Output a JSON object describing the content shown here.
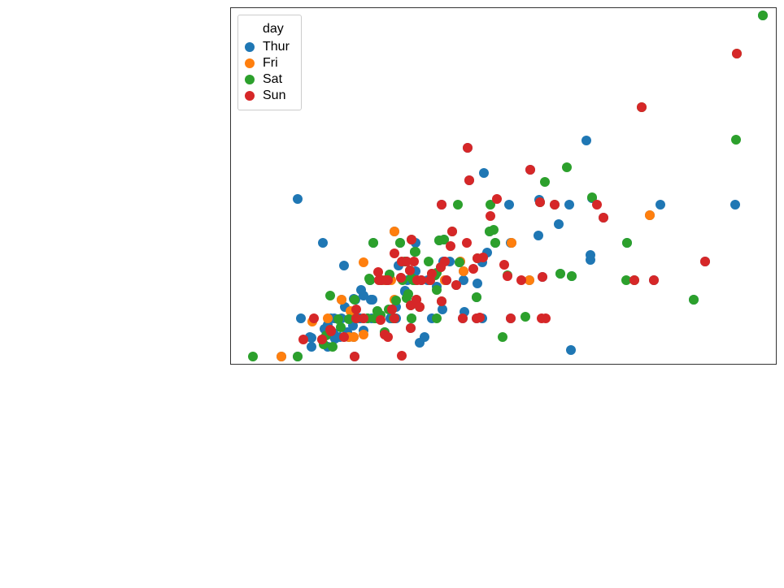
{
  "chart_data": {
    "type": "scatter",
    "legend_title": "day",
    "legend_labels": [
      "Thur",
      "Fri",
      "Sat",
      "Sun"
    ],
    "colors": {
      "Thur": "#1f77b4",
      "Fri": "#ff7f0e",
      "Sat": "#2ca02c",
      "Sun": "#d62728"
    },
    "xlim": [
      1,
      52
    ],
    "ylim": [
      0.8,
      10.2
    ],
    "series": [
      {
        "name": "Thur",
        "points": [
          [
            27.2,
            4.0
          ],
          [
            22.76,
            3.0
          ],
          [
            17.29,
            2.71
          ],
          [
            19.44,
            3.0
          ],
          [
            16.66,
            3.4
          ],
          [
            10.07,
            1.83
          ],
          [
            32.68,
            5.0
          ],
          [
            15.98,
            2.03
          ],
          [
            34.83,
            5.17
          ],
          [
            13.03,
            2.0
          ],
          [
            18.28,
            4.0
          ],
          [
            24.71,
            5.85
          ],
          [
            21.16,
            3.0
          ],
          [
            28.97,
            3.0
          ],
          [
            22.49,
            3.5
          ],
          [
            5.75,
            1.0
          ],
          [
            16.32,
            4.3
          ],
          [
            22.75,
            3.25
          ],
          [
            40.17,
            4.73
          ],
          [
            27.28,
            4.0
          ],
          [
            12.03,
            1.5
          ],
          [
            21.01,
            3.0
          ],
          [
            12.46,
            1.5
          ],
          [
            11.35,
            2.5
          ],
          [
            15.38,
            3.0
          ],
          [
            44.3,
            2.5
          ],
          [
            22.42,
            3.48
          ],
          [
            20.92,
            4.08
          ],
          [
            15.36,
            1.64
          ],
          [
            20.49,
            4.06
          ],
          [
            25.21,
            4.29
          ],
          [
            18.24,
            3.76
          ],
          [
            14.31,
            4.0
          ],
          [
            14.0,
            3.0
          ],
          [
            7.25,
            1.0
          ],
          [
            38.07,
            4.0
          ],
          [
            23.95,
            2.55
          ],
          [
            25.71,
            4.0
          ],
          [
            17.31,
            3.5
          ],
          [
            29.93,
            5.07
          ],
          [
            10.65,
            1.5
          ],
          [
            12.43,
            1.8
          ],
          [
            24.08,
            2.92
          ],
          [
            11.69,
            2.31
          ],
          [
            13.42,
            1.68
          ],
          [
            14.26,
            2.5
          ],
          [
            15.95,
            2.0
          ],
          [
            12.48,
            2.52
          ],
          [
            29.8,
            4.2
          ],
          [
            8.52,
            1.48
          ],
          [
            14.52,
            2.0
          ],
          [
            11.38,
            2.0
          ],
          [
            22.82,
            2.18
          ],
          [
            19.08,
            1.5
          ],
          [
            20.27,
            2.83
          ],
          [
            11.17,
            1.5
          ],
          [
            12.26,
            2.0
          ],
          [
            18.26,
            3.25
          ],
          [
            8.51,
            1.25
          ],
          [
            10.33,
            2.0
          ],
          [
            14.15,
            2.0
          ],
          [
            16.0,
            2.0
          ],
          [
            13.16,
            2.75
          ],
          [
            17.47,
            3.5
          ],
          [
            34.3,
            6.7
          ],
          [
            41.19,
            5.0
          ],
          [
            27.05,
            5.0
          ],
          [
            16.43,
            2.3
          ],
          [
            8.35,
            1.5
          ],
          [
            18.64,
            1.36
          ],
          [
            11.87,
            1.63
          ],
          [
            9.78,
            1.73
          ],
          [
            7.51,
            2.0
          ],
          [
            14.07,
            2.5
          ],
          [
            13.13,
            2.0
          ],
          [
            17.26,
            2.74
          ],
          [
            24.55,
            2.0
          ],
          [
            19.77,
            2.0
          ],
          [
            29.85,
            5.14
          ],
          [
            48.17,
            5.0
          ],
          [
            25.0,
            3.75
          ],
          [
            13.39,
            2.61
          ],
          [
            16.49,
            2.0
          ],
          [
            21.5,
            3.5
          ],
          [
            12.66,
            2.5
          ],
          [
            16.21,
            2.0
          ],
          [
            13.81,
            2.0
          ],
          [
            17.51,
            3.0
          ],
          [
            24.52,
            3.48
          ],
          [
            20.76,
            2.24
          ],
          [
            31.71,
            4.5
          ],
          [
            10.59,
            1.61
          ],
          [
            10.63,
            2.0
          ],
          [
            50.81,
            10.0
          ],
          [
            15.81,
            3.16
          ],
          [
            7.25,
            5.15
          ],
          [
            31.85,
            3.18
          ],
          [
            16.82,
            4.0
          ],
          [
            32.9,
            3.11
          ],
          [
            17.89,
            2.0
          ],
          [
            14.48,
            2.0
          ],
          [
            9.6,
            4.0
          ],
          [
            34.63,
            3.55
          ],
          [
            34.65,
            3.68
          ],
          [
            23.33,
            5.65
          ],
          [
            45.35,
            3.5
          ],
          [
            23.17,
            6.5
          ],
          [
            40.55,
            3.0
          ],
          [
            20.69,
            5.0
          ],
          [
            20.9,
            3.5
          ],
          [
            30.14,
            3.09
          ],
          [
            22.12,
            2.88
          ],
          [
            24.01,
            2.0
          ],
          [
            15.69,
            3.0
          ],
          [
            11.61,
            3.39
          ],
          [
            10.77,
            1.47
          ],
          [
            15.53,
            3.0
          ],
          [
            10.07,
            1.25
          ],
          [
            12.6,
            1.0
          ],
          [
            32.83,
            1.17
          ],
          [
            35.83,
            4.67
          ],
          [
            29.03,
            5.92
          ],
          [
            27.18,
            2.0
          ],
          [
            22.67,
            2.0
          ],
          [
            17.82,
            1.75
          ],
          [
            18.78,
            3.0
          ]
        ]
      },
      {
        "name": "Fri",
        "points": [
          [
            28.97,
            3.0
          ],
          [
            22.49,
            3.5
          ],
          [
            5.75,
            1.0
          ],
          [
            16.32,
            4.3
          ],
          [
            22.75,
            3.25
          ],
          [
            40.17,
            4.73
          ],
          [
            27.28,
            4.0
          ],
          [
            12.03,
            1.5
          ],
          [
            21.01,
            3.0
          ],
          [
            12.46,
            1.5
          ],
          [
            11.35,
            2.5
          ],
          [
            15.38,
            3.0
          ],
          [
            8.58,
            1.92
          ],
          [
            15.98,
            3.0
          ],
          [
            13.42,
            3.48
          ],
          [
            16.27,
            2.5
          ],
          [
            10.09,
            2.0
          ],
          [
            12.16,
            2.2
          ],
          [
            13.42,
            1.58
          ]
        ]
      },
      {
        "name": "Sat",
        "points": [
          [
            20.65,
            3.35
          ],
          [
            17.92,
            4.08
          ],
          [
            20.29,
            2.75
          ],
          [
            15.77,
            2.23
          ],
          [
            39.42,
            7.58
          ],
          [
            19.82,
            3.18
          ],
          [
            17.81,
            2.34
          ],
          [
            13.37,
            2.0
          ],
          [
            12.69,
            2.0
          ],
          [
            21.7,
            4.3
          ],
          [
            19.65,
            3.0
          ],
          [
            9.55,
            1.45
          ],
          [
            18.35,
            2.5
          ],
          [
            15.06,
            3.0
          ],
          [
            20.69,
            2.45
          ],
          [
            17.78,
            3.27
          ],
          [
            24.06,
            3.6
          ],
          [
            16.31,
            2.0
          ],
          [
            16.93,
            3.07
          ],
          [
            18.69,
            2.31
          ],
          [
            31.27,
            5.0
          ],
          [
            16.04,
            2.24
          ],
          [
            17.46,
            2.54
          ],
          [
            13.94,
            3.06
          ],
          [
            9.68,
            1.32
          ],
          [
            30.4,
            5.6
          ],
          [
            18.29,
            3.0
          ],
          [
            22.23,
            5.0
          ],
          [
            32.4,
            6.0
          ],
          [
            28.55,
            2.05
          ],
          [
            18.04,
            3.0
          ],
          [
            12.54,
            2.5
          ],
          [
            10.29,
            2.6
          ],
          [
            34.81,
            5.2
          ],
          [
            9.94,
            1.56
          ],
          [
            25.56,
            4.34
          ],
          [
            19.49,
            3.51
          ],
          [
            38.01,
            3.0
          ],
          [
            26.41,
            1.5
          ],
          [
            11.24,
            1.76
          ],
          [
            48.27,
            6.73
          ],
          [
            20.29,
            3.21
          ],
          [
            13.81,
            2.0
          ],
          [
            11.02,
            1.98
          ],
          [
            18.29,
            3.76
          ],
          [
            17.59,
            2.64
          ],
          [
            20.08,
            3.15
          ],
          [
            16.45,
            2.47
          ],
          [
            3.07,
            1.0
          ],
          [
            20.23,
            2.01
          ],
          [
            15.01,
            2.09
          ],
          [
            12.02,
            1.97
          ],
          [
            17.07,
            3.0
          ],
          [
            26.86,
            3.14
          ],
          [
            25.28,
            5.0
          ],
          [
            14.73,
            2.2
          ],
          [
            10.51,
            1.25
          ],
          [
            17.92,
            3.08
          ],
          [
            44.3,
            2.5
          ],
          [
            22.42,
            3.48
          ],
          [
            20.92,
            4.08
          ],
          [
            15.36,
            1.64
          ],
          [
            20.49,
            4.06
          ],
          [
            25.21,
            4.29
          ],
          [
            18.24,
            3.76
          ],
          [
            14.31,
            4.0
          ],
          [
            14.0,
            3.0
          ],
          [
            7.25,
            1.0
          ],
          [
            38.07,
            4.0
          ],
          [
            23.95,
            2.55
          ],
          [
            25.71,
            4.0
          ],
          [
            17.31,
            3.5
          ],
          [
            29.93,
            5.07
          ],
          [
            14.73,
            2.2
          ],
          [
            16.21,
            2.0
          ],
          [
            50.81,
            10.0
          ],
          [
            15.81,
            3.16
          ],
          [
            31.85,
            3.18
          ],
          [
            16.82,
            4.0
          ],
          [
            32.9,
            3.11
          ],
          [
            17.89,
            2.0
          ],
          [
            14.48,
            2.0
          ],
          [
            48.33,
            9.0
          ],
          [
            38.73,
            3.0
          ]
        ]
      },
      {
        "name": "Sun",
        "points": [
          [
            16.99,
            1.01
          ],
          [
            10.34,
            1.66
          ],
          [
            21.01,
            3.5
          ],
          [
            23.68,
            3.31
          ],
          [
            24.59,
            3.61
          ],
          [
            25.29,
            4.71
          ],
          [
            8.77,
            2.0
          ],
          [
            26.88,
            3.12
          ],
          [
            15.04,
            1.96
          ],
          [
            14.78,
            3.23
          ],
          [
            10.27,
            1.71
          ],
          [
            35.26,
            5.0
          ],
          [
            15.42,
            1.57
          ],
          [
            18.43,
            3.0
          ],
          [
            14.83,
            3.02
          ],
          [
            21.58,
            3.92
          ],
          [
            10.33,
            1.67
          ],
          [
            16.29,
            3.71
          ],
          [
            16.97,
            3.5
          ],
          [
            20.65,
            3.35
          ],
          [
            17.92,
            4.08
          ],
          [
            39.42,
            7.58
          ],
          [
            19.82,
            3.18
          ],
          [
            17.81,
            2.34
          ],
          [
            13.37,
            2.0
          ],
          [
            12.69,
            2.0
          ],
          [
            21.7,
            4.3
          ],
          [
            19.65,
            3.0
          ],
          [
            9.55,
            1.45
          ],
          [
            18.35,
            2.5
          ],
          [
            15.06,
            3.0
          ],
          [
            20.69,
            2.45
          ],
          [
            17.78,
            3.27
          ],
          [
            24.06,
            3.6
          ],
          [
            16.31,
            2.0
          ],
          [
            16.93,
            3.07
          ],
          [
            18.69,
            2.31
          ],
          [
            31.27,
            5.0
          ],
          [
            16.04,
            2.24
          ],
          [
            29.93,
            5.07
          ],
          [
            22.67,
            2.0
          ],
          [
            17.82,
            1.75
          ],
          [
            18.78,
            3.0
          ],
          [
            23.33,
            5.65
          ],
          [
            45.35,
            3.5
          ],
          [
            23.17,
            6.5
          ],
          [
            40.55,
            3.0
          ],
          [
            20.69,
            5.0
          ],
          [
            30.46,
            2.0
          ],
          [
            18.15,
            3.5
          ],
          [
            23.1,
            4.0
          ],
          [
            15.69,
            1.5
          ],
          [
            26.59,
            3.41
          ],
          [
            38.73,
            3.0
          ],
          [
            24.27,
            2.03
          ],
          [
            12.76,
            2.23
          ],
          [
            30.06,
            2.0
          ],
          [
            25.89,
            5.16
          ],
          [
            48.33,
            9.0
          ],
          [
            28.15,
            3.0
          ],
          [
            11.59,
            1.5
          ],
          [
            7.74,
            1.44
          ],
          [
            30.14,
            3.09
          ],
          [
            22.12,
            2.88
          ],
          [
            24.01,
            2.0
          ],
          [
            15.69,
            3.0
          ],
          [
            15.53,
            3.0
          ],
          [
            12.6,
            1.0
          ],
          [
            35.83,
            4.67
          ],
          [
            29.03,
            5.92
          ],
          [
            27.18,
            2.0
          ],
          [
            21.16,
            3.0
          ],
          [
            17.47,
            3.5
          ]
        ]
      }
    ]
  }
}
